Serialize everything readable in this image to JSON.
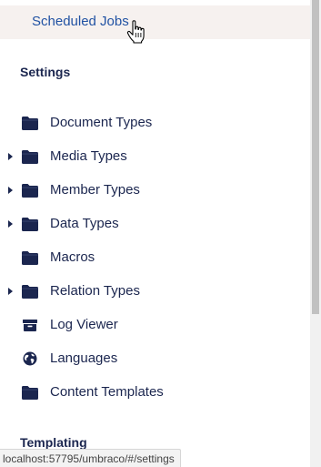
{
  "hovered_item": {
    "label": "Scheduled Jobs"
  },
  "sections": {
    "settings": {
      "title": "Settings",
      "items": [
        {
          "label": "Document Types",
          "icon": "folder-icon",
          "expandable": false
        },
        {
          "label": "Media Types",
          "icon": "folder-icon",
          "expandable": true
        },
        {
          "label": "Member Types",
          "icon": "folder-icon",
          "expandable": true
        },
        {
          "label": "Data Types",
          "icon": "folder-icon",
          "expandable": true
        },
        {
          "label": "Macros",
          "icon": "folder-icon",
          "expandable": false
        },
        {
          "label": "Relation Types",
          "icon": "folder-icon",
          "expandable": true
        },
        {
          "label": "Log Viewer",
          "icon": "archive-box-icon",
          "expandable": false
        },
        {
          "label": "Languages",
          "icon": "globe-icon",
          "expandable": false
        },
        {
          "label": "Content Templates",
          "icon": "folder-icon",
          "expandable": false
        }
      ]
    },
    "templating": {
      "title": "Templating"
    }
  },
  "status_bar": {
    "url": "localhost:57795/umbraco/#/settings"
  },
  "colors": {
    "text": "#1b264f",
    "link": "#2152a3",
    "hover_bg": "#f6f1ef"
  }
}
